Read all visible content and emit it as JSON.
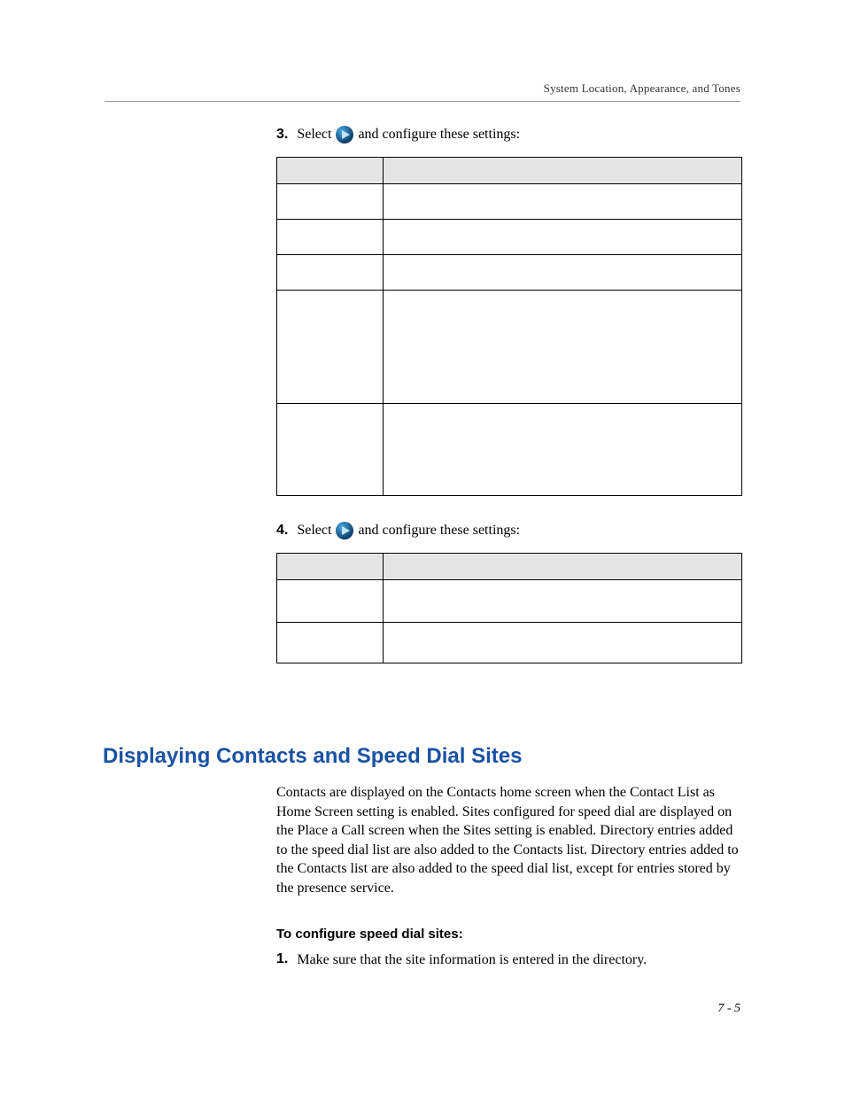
{
  "header": {
    "section_title": "System Location, Appearance, and Tones"
  },
  "steps": {
    "step3": {
      "number": "3.",
      "before": "Select",
      "after": "and configure these settings:",
      "icon_name": "play-icon"
    },
    "step4": {
      "number": "4.",
      "before": "Select",
      "after": "and configure these settings:",
      "icon_name": "play-icon"
    }
  },
  "table1": {
    "header_setting": "",
    "header_description": "",
    "rows": [
      {
        "setting": "",
        "description": ""
      },
      {
        "setting": "",
        "description": ""
      },
      {
        "setting": "",
        "description": ""
      },
      {
        "setting": "",
        "description": ""
      },
      {
        "setting": "",
        "description": ""
      }
    ]
  },
  "table2": {
    "header_setting": "",
    "header_description": "",
    "rows": [
      {
        "setting": "",
        "description": ""
      },
      {
        "setting": "",
        "description": ""
      }
    ]
  },
  "section": {
    "heading": "Displaying Contacts and Speed Dial Sites",
    "paragraph": "Contacts are displayed on the Contacts home screen when the Contact List as Home Screen setting is enabled. Sites configured for speed dial are displayed on the Place a Call screen when the Sites setting is enabled. Directory entries added to the speed dial list are also added to the Contacts list. Directory entries added to the Contacts list are also added to the speed dial list, except for entries stored by the presence service.",
    "subheading": "To configure speed dial sites:",
    "substep1_num": "1.",
    "substep1_text": "Make sure that the site information is entered in the directory."
  },
  "page_number": "7 - 5"
}
